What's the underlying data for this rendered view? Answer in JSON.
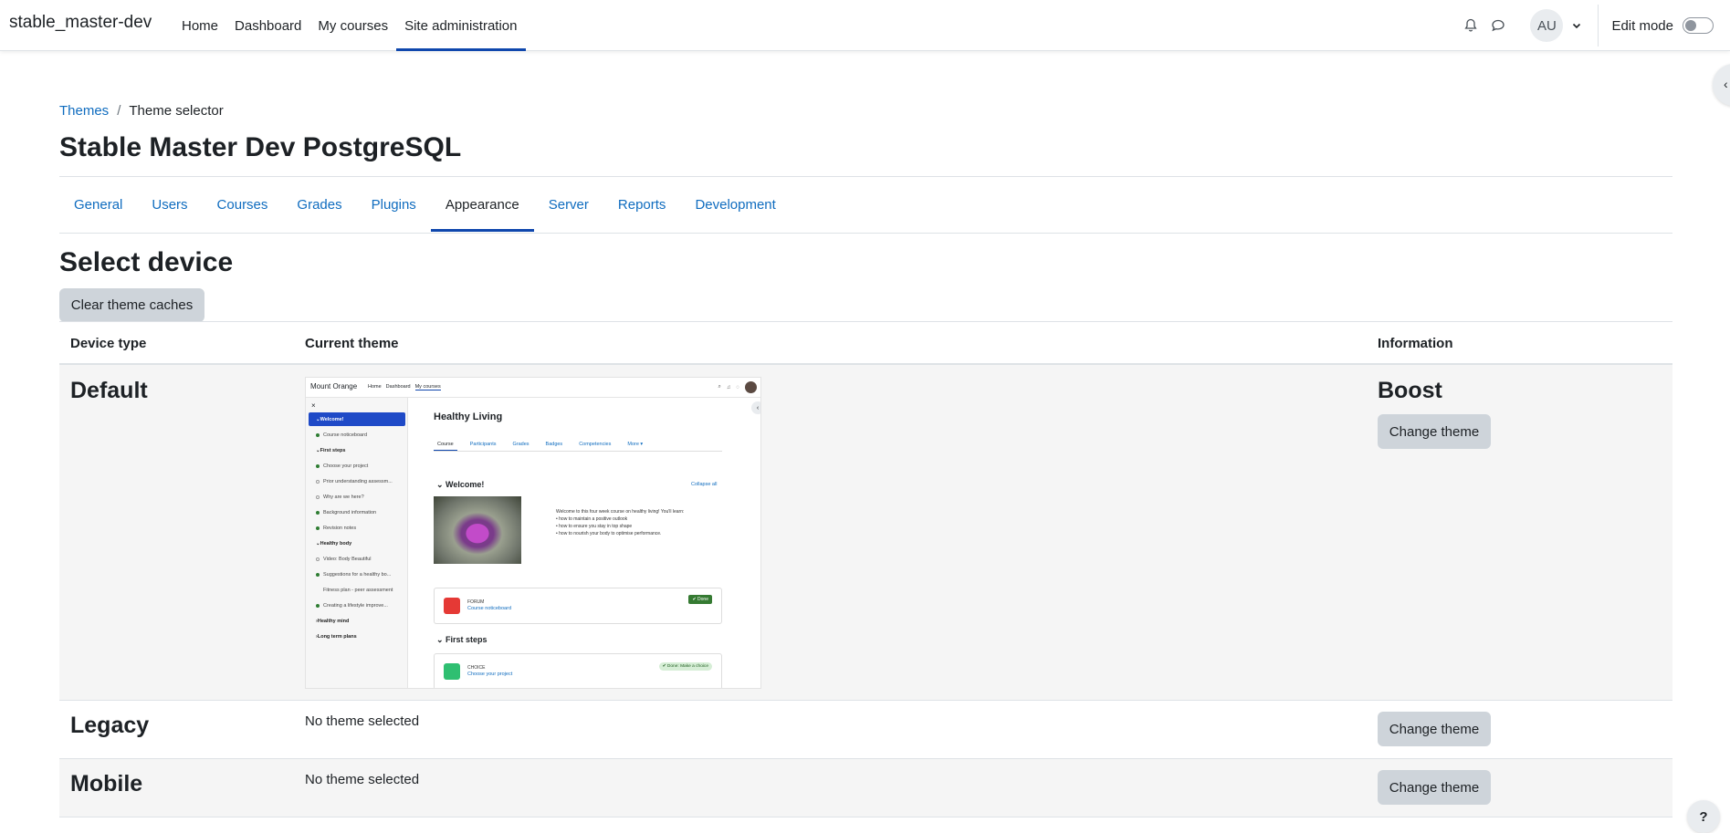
{
  "navbar": {
    "brand": "stable_master-dev",
    "items": [
      "Home",
      "Dashboard",
      "My courses",
      "Site administration"
    ],
    "active_index": 3,
    "avatar_initials": "AU",
    "edit_mode_label": "Edit mode"
  },
  "breadcrumb": {
    "parent": "Themes",
    "separator": "/",
    "current": "Theme selector"
  },
  "page_title": "Stable Master Dev PostgreSQL",
  "secondary_nav": {
    "tabs": [
      "General",
      "Users",
      "Courses",
      "Grades",
      "Plugins",
      "Appearance",
      "Server",
      "Reports",
      "Development"
    ],
    "active_index": 5
  },
  "section_title": "Select device",
  "clear_caches_label": "Clear theme caches",
  "table": {
    "headers": [
      "Device type",
      "Current theme",
      "Information"
    ],
    "rows": [
      {
        "device": "Default",
        "theme": "Boost",
        "action": "Change theme"
      },
      {
        "device": "Legacy",
        "current": "No theme selected",
        "action": "Change theme"
      },
      {
        "device": "Mobile",
        "current": "No theme selected",
        "action": "Change theme"
      }
    ]
  },
  "preview": {
    "brand": "Mount Orange",
    "links": [
      "Home",
      "Dashboard",
      "My courses"
    ],
    "sidebar": [
      {
        "label": "Welcome!",
        "type": "selected"
      },
      {
        "label": "Course noticeboard",
        "type": "done"
      },
      {
        "label": "First steps",
        "type": "heading"
      },
      {
        "label": "Choose your project",
        "type": "done"
      },
      {
        "label": "Prior understanding assessm...",
        "type": "open"
      },
      {
        "label": "Why are we here?",
        "type": "open"
      },
      {
        "label": "Background information",
        "type": "done"
      },
      {
        "label": "Revision notes",
        "type": "done"
      },
      {
        "label": "Healthy body",
        "type": "heading"
      },
      {
        "label": "Video: Body Beautiful",
        "type": "open"
      },
      {
        "label": "Suggestions for a healthy bo...",
        "type": "done"
      },
      {
        "label": "Fitness plan - peer assessment",
        "type": "none"
      },
      {
        "label": "Creating a lifestyle improve...",
        "type": "done"
      },
      {
        "label": "Healthy mind",
        "type": "heading-collapsed"
      },
      {
        "label": "Long term plans",
        "type": "heading-collapsed"
      }
    ],
    "course_title": "Healthy Living",
    "tabs": [
      "Course",
      "Participants",
      "Grades",
      "Badges",
      "Competencies",
      "More ▾"
    ],
    "section1": "Welcome!",
    "collapse_all": "Collapse all",
    "intro": "Welcome to this four week course on healthy living! You'll learn:",
    "bullets": [
      "how to maintain a positive outlook",
      "how to ensure you stay in top shape",
      "how to nourish your body to optimise performance."
    ],
    "forum_type": "FORUM",
    "forum_link": "Course noticeboard",
    "done_label": "✔ Done",
    "section2": "First steps",
    "choice_type": "CHOICE",
    "choice_link": "Choose your project",
    "choice_done": "✔ Done: Make a choice"
  },
  "colors": {
    "link": "#0f6cbf",
    "active_underline": "#0f47ad",
    "button_bg": "#ced4da"
  }
}
